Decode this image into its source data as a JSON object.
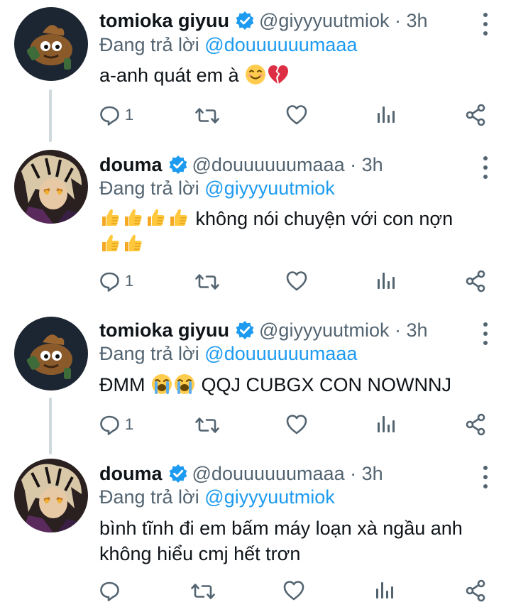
{
  "tweets": [
    {
      "name": "tomioka giyuu",
      "handle": "@giyyyuutmiok",
      "dot": "·",
      "time": "3h",
      "reply_prefix": "Đang trả lời",
      "reply_to": "@douuuuuumaaa",
      "text": "a-anh quát em à",
      "emojis": [
        "smiling-face-emoji",
        "broken-heart-emoji"
      ],
      "reply_count": "1",
      "avatar": "poop-cartoon-avatar"
    },
    {
      "name": "douma",
      "handle": "@douuuuuumaaa",
      "dot": "·",
      "time": "3h",
      "reply_prefix": "Đang trả lời",
      "reply_to": "@giyyyuutmiok",
      "text": "không nói chuyện với con nợn",
      "emojis": [
        "thumbs-up-emoji",
        "thumbs-up-emoji",
        "thumbs-up-emoji",
        "thumbs-up-emoji",
        "thumbs-up-emoji",
        "thumbs-up-emoji"
      ],
      "reply_count": "1",
      "avatar": "anime-character-avatar"
    },
    {
      "name": "tomioka giyuu",
      "handle": "@giyyyuutmiok",
      "dot": "·",
      "time": "3h",
      "reply_prefix": "Đang trả lời",
      "reply_to": "@douuuuuumaaa",
      "text_before": "ĐMM",
      "text_after": "QQJ CUBGX CON NOWNNJ",
      "emojis": [
        "loudly-crying-emoji",
        "loudly-crying-emoji"
      ],
      "reply_count": "1",
      "avatar": "poop-cartoon-avatar"
    },
    {
      "name": "douma",
      "handle": "@douuuuuumaaa",
      "dot": "·",
      "time": "3h",
      "reply_prefix": "Đang trả lời",
      "reply_to": "@giyyyuutmiok",
      "text_line1": "bình tĩnh đi em bấm máy loạn xà ngầu anh",
      "text_line2": "không hiểu cmj hết trơn",
      "reply_count": "",
      "avatar": "anime-character-avatar"
    }
  ],
  "colors": {
    "accent": "#1d9bf0",
    "secondary_text": "#536471",
    "thread_line": "#cfd9de"
  }
}
